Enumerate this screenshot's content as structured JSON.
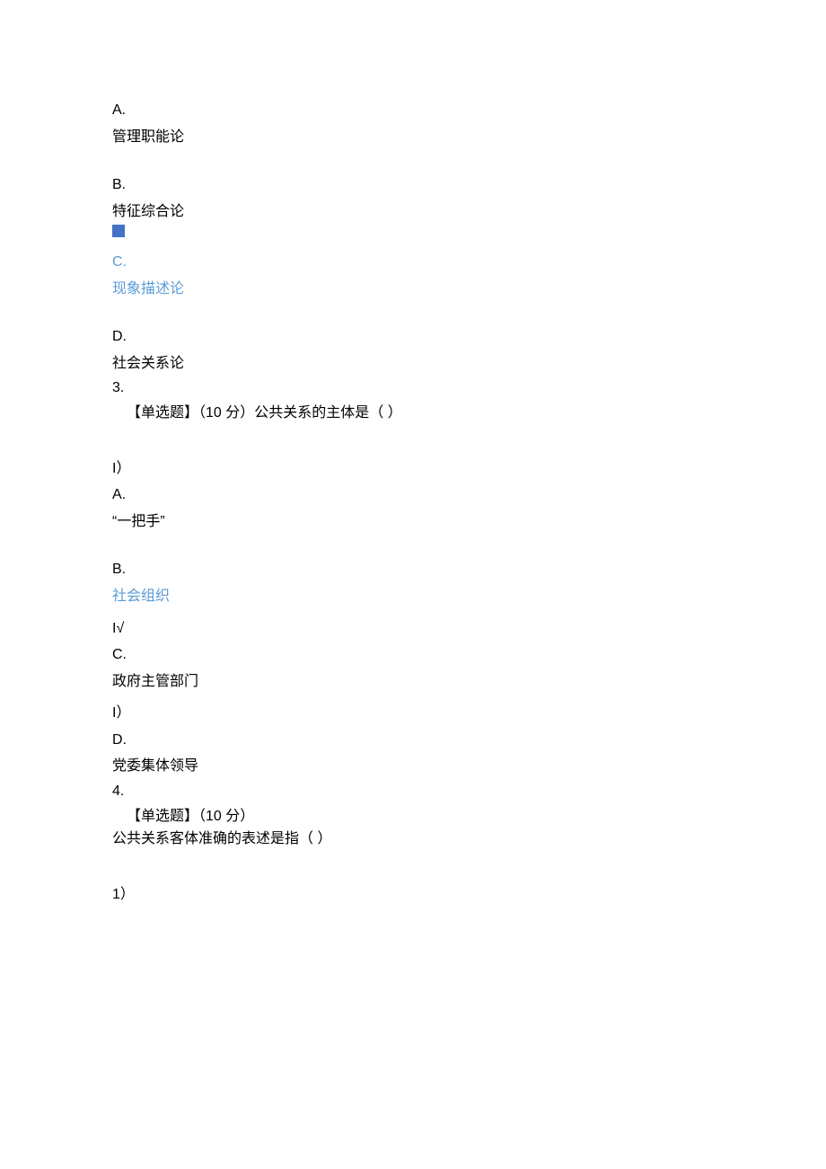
{
  "q2": {
    "options": {
      "a": {
        "letter": "A.",
        "text": "管理职能论"
      },
      "b": {
        "letter": "B.",
        "text": "特征综合论"
      },
      "c": {
        "letter": "C.",
        "text": "现象描述论"
      },
      "d": {
        "letter": "D.",
        "text": "社会关系论"
      }
    }
  },
  "q3": {
    "number": "3.",
    "stem": "【单选题】（10 分）公共关系的主体是（ ）",
    "options": {
      "a": {
        "marker": "I）",
        "letter": "A.",
        "text": "“一把手”"
      },
      "b": {
        "marker": "",
        "letter": "B.",
        "text": "社会组织"
      },
      "c": {
        "marker": "I√",
        "letter": "C.",
        "text": "政府主管部门"
      },
      "d": {
        "marker": "I）",
        "letter": "D.",
        "text": "党委集体领导"
      }
    }
  },
  "q4": {
    "number": "4.",
    "stem_line1": "【单选题】（10 分）",
    "stem_line2": "公共关系客体准确的表述是指（ ）",
    "marker": "1）"
  }
}
